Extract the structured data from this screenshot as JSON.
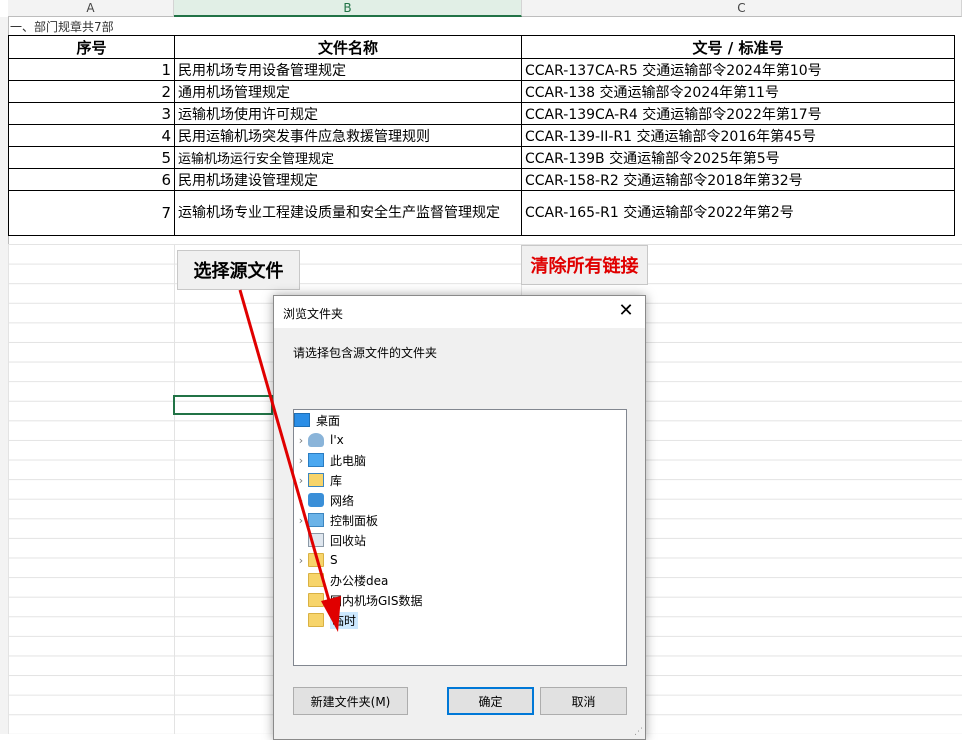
{
  "sheet": {
    "columns": [
      "A",
      "B",
      "C"
    ],
    "section_title": "一、部门规章共7部",
    "table": {
      "headers": [
        "序号",
        "文件名称",
        "文号 / 标准号"
      ],
      "rows": [
        {
          "no": "1",
          "name": "民用机场专用设备管理规定",
          "code": "CCAR-137CA-R5 交通运输部令2024年第10号"
        },
        {
          "no": "2",
          "name": "通用机场管理规定",
          "code": "CCAR-138 交通运输部令2024年第11号"
        },
        {
          "no": "3",
          "name": "运输机场使用许可规定",
          "code": "CCAR-139CA-R4 交通运输部令2022年第17号"
        },
        {
          "no": "4",
          "name": "民用运输机场突发事件应急救援管理规则",
          "code": "CCAR-139-II-R1 交通运输部令2016年第45号"
        },
        {
          "no": "5",
          "name": "运输机场运行安全管理规定",
          "code": "CCAR-139B 交通运输部令2025年第5号"
        },
        {
          "no": "6",
          "name": "民用机场建设管理规定",
          "code": "CCAR-158-R2 交通运输部令2018年第32号"
        },
        {
          "no": "7",
          "name": "运输机场专业工程建设质量和安全生产监督管理规定",
          "code": "CCAR-165-R1 交通运输部令2022年第2号"
        }
      ]
    },
    "buttons": {
      "select_source": "选择源文件",
      "clear_links": "清除所有链接"
    },
    "colors": {
      "clear_links_text": "#e00000",
      "arrow": "#e00000",
      "selection": "#217346"
    }
  },
  "dialog": {
    "title": "浏览文件夹",
    "prompt": "请选择包含源文件的文件夹",
    "tree": [
      {
        "label": "桌面",
        "icon": "desktop-icon",
        "expandable": false,
        "indent": 0
      },
      {
        "label": "l'x",
        "icon": "user-icon",
        "expandable": true,
        "indent": 1
      },
      {
        "label": "此电脑",
        "icon": "computer-icon",
        "expandable": true,
        "indent": 1
      },
      {
        "label": "库",
        "icon": "library-icon",
        "expandable": true,
        "indent": 1
      },
      {
        "label": "网络",
        "icon": "network-icon",
        "expandable": true,
        "indent": 1
      },
      {
        "label": "控制面板",
        "icon": "control-panel-icon",
        "expandable": true,
        "indent": 1
      },
      {
        "label": "回收站",
        "icon": "recycle-bin-icon",
        "expandable": false,
        "indent": 1
      },
      {
        "label": "S",
        "icon": "folder-icon",
        "expandable": true,
        "indent": 1
      },
      {
        "label": "办公楼dea",
        "icon": "folder-icon",
        "expandable": false,
        "indent": 1
      },
      {
        "label": "国内机场GIS数据",
        "icon": "folder-icon",
        "expandable": false,
        "indent": 1
      },
      {
        "label": "临时",
        "icon": "folder-icon",
        "expandable": false,
        "indent": 1,
        "selected": true
      }
    ],
    "buttons": {
      "new_folder": "新建文件夹(M)",
      "ok": "确定",
      "cancel": "取消"
    }
  }
}
